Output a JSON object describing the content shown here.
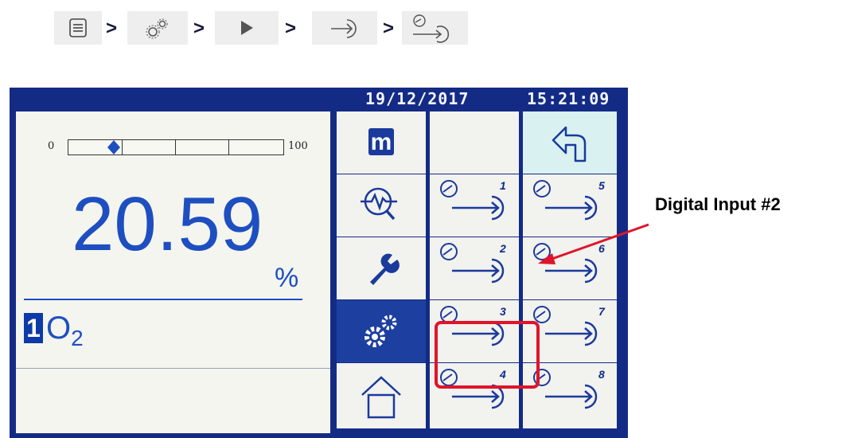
{
  "breadcrumb": {
    "items": [
      {
        "icon": "menu-list-icon"
      },
      {
        "icon": "gears-icon"
      },
      {
        "icon": "play-icon"
      },
      {
        "icon": "input-arrow-icon"
      },
      {
        "icon": "digital-input-icon"
      }
    ],
    "separator": ">"
  },
  "device": {
    "date": "19/12/2017",
    "time": "15:21:09",
    "bar_min": "0",
    "bar_max": "100",
    "bar_level_percent": 21,
    "reading": "20.59",
    "unit": "%",
    "channel": "1",
    "gas": "O",
    "gas_sub": "2",
    "menu": {
      "m_label": "m",
      "nav": [
        "monitor-icon",
        "wrench-icon",
        "gears-icon",
        "home-icon"
      ],
      "back": "back-arrow-icon",
      "inputs": [
        "1",
        "2",
        "3",
        "4",
        "5",
        "6",
        "7",
        "8"
      ]
    }
  },
  "annotation": {
    "label": "Digital Input #2",
    "color": "#e0142a"
  }
}
